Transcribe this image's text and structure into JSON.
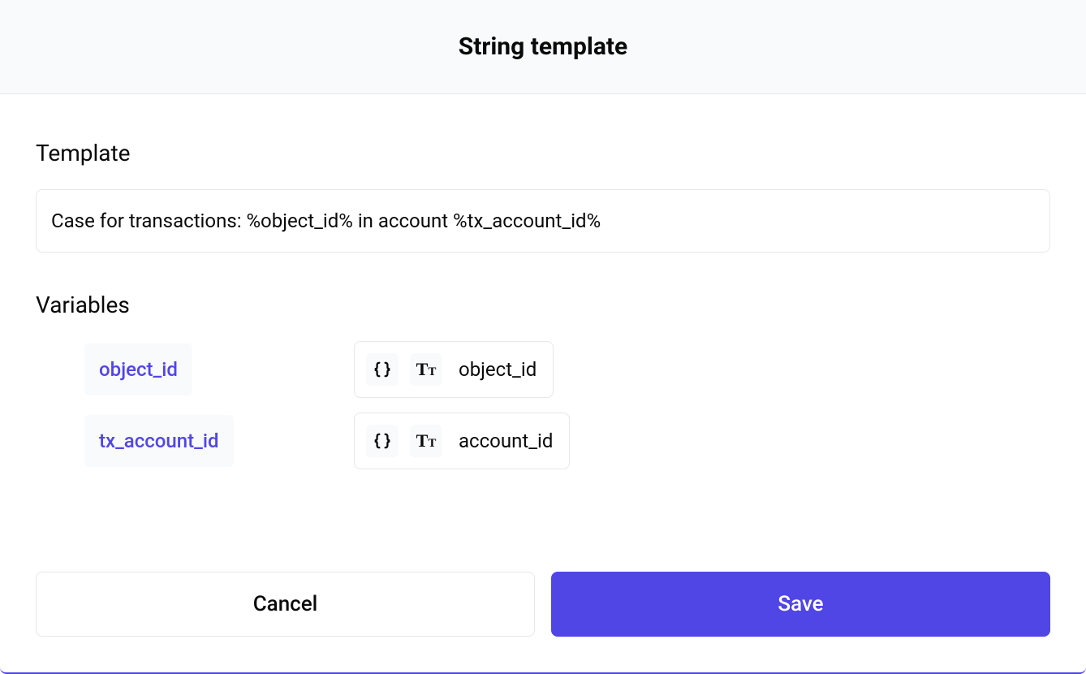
{
  "header": {
    "title": "String template"
  },
  "template": {
    "label": "Template",
    "value": "Case for transactions: %object_id% in account %tx_account_id%"
  },
  "variables": {
    "label": "Variables",
    "items": [
      {
        "name": "object_id",
        "value": "object_id"
      },
      {
        "name": "tx_account_id",
        "value": "account_id"
      }
    ]
  },
  "footer": {
    "cancel_label": "Cancel",
    "save_label": "Save"
  },
  "colors": {
    "accent": "#5046e5"
  }
}
